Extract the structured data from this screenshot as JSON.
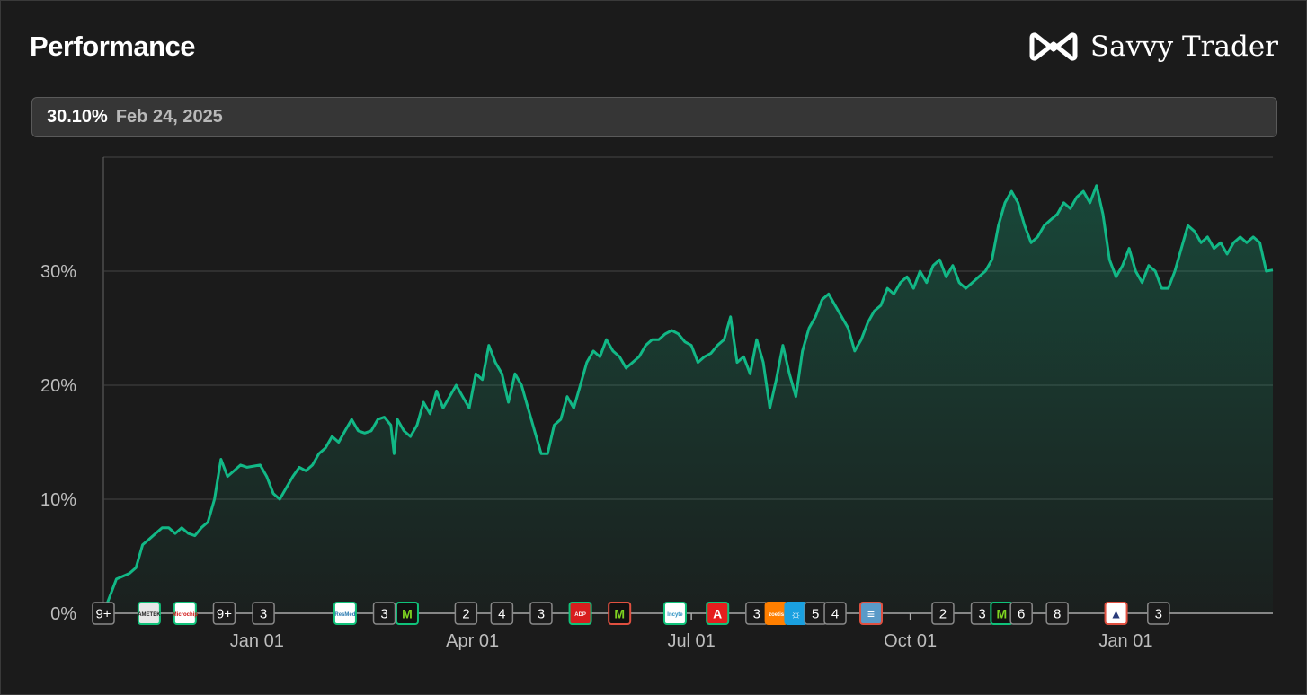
{
  "header": {
    "title": "Performance",
    "brand": "Savvy Trader"
  },
  "tooltip": {
    "value": "30.10%",
    "date": "Feb 24, 2025"
  },
  "colors": {
    "line": "#12b886",
    "grid": "#444444",
    "positive": "#10c27a",
    "negative": "#e05040"
  },
  "chart_data": {
    "type": "area",
    "x_labels": [
      "Jan 01",
      "Apr 01",
      "Jul 01",
      "Oct 01",
      "Jan 01"
    ],
    "y_tick_labels": [
      "0%",
      "10%",
      "20%",
      "30%"
    ],
    "ylim": [
      0,
      40
    ],
    "grid": true,
    "series": [
      {
        "points": [
          [
            0,
            0
          ],
          [
            4,
            3
          ],
          [
            8,
            3.5
          ],
          [
            10,
            4
          ],
          [
            12,
            6
          ],
          [
            14,
            6.5
          ],
          [
            16,
            7
          ],
          [
            18,
            7.5
          ],
          [
            20,
            7.5
          ],
          [
            22,
            7
          ],
          [
            24,
            7.5
          ],
          [
            26,
            7
          ],
          [
            28,
            6.8
          ],
          [
            30,
            7.5
          ],
          [
            32,
            8
          ],
          [
            34,
            10
          ],
          [
            36,
            13.5
          ],
          [
            38,
            12
          ],
          [
            40,
            12.5
          ],
          [
            42,
            13
          ],
          [
            44,
            12.8
          ],
          [
            48,
            13
          ],
          [
            50,
            12
          ],
          [
            52,
            10.5
          ],
          [
            54,
            10
          ],
          [
            56,
            11
          ],
          [
            58,
            12
          ],
          [
            60,
            12.8
          ],
          [
            62,
            12.5
          ],
          [
            64,
            13
          ],
          [
            66,
            14
          ],
          [
            68,
            14.5
          ],
          [
            70,
            15.5
          ],
          [
            72,
            15
          ],
          [
            74,
            16
          ],
          [
            76,
            17
          ],
          [
            78,
            16
          ],
          [
            80,
            15.8
          ],
          [
            82,
            16
          ],
          [
            84,
            17
          ],
          [
            86,
            17.2
          ],
          [
            88,
            16.5
          ],
          [
            89,
            14
          ],
          [
            90,
            17
          ],
          [
            92,
            16
          ],
          [
            94,
            15.5
          ],
          [
            96,
            16.5
          ],
          [
            98,
            18.5
          ],
          [
            100,
            17.5
          ],
          [
            102,
            19.5
          ],
          [
            104,
            18
          ],
          [
            106,
            19
          ],
          [
            108,
            20
          ],
          [
            110,
            19
          ],
          [
            112,
            18
          ],
          [
            114,
            21
          ],
          [
            116,
            20.5
          ],
          [
            118,
            23.5
          ],
          [
            120,
            22
          ],
          [
            122,
            21
          ],
          [
            124,
            18.5
          ],
          [
            126,
            21
          ],
          [
            128,
            20
          ],
          [
            130,
            18
          ],
          [
            132,
            16
          ],
          [
            134,
            14
          ],
          [
            136,
            14
          ],
          [
            138,
            16.5
          ],
          [
            140,
            17
          ],
          [
            142,
            19
          ],
          [
            144,
            18
          ],
          [
            146,
            20
          ],
          [
            148,
            22
          ],
          [
            150,
            23
          ],
          [
            152,
            22.5
          ],
          [
            154,
            24
          ],
          [
            156,
            23
          ],
          [
            158,
            22.5
          ],
          [
            160,
            21.5
          ],
          [
            162,
            22
          ],
          [
            164,
            22.5
          ],
          [
            166,
            23.5
          ],
          [
            168,
            24
          ],
          [
            170,
            24
          ],
          [
            172,
            24.5
          ],
          [
            174,
            24.8
          ],
          [
            176,
            24.5
          ],
          [
            178,
            23.8
          ],
          [
            180,
            23.5
          ],
          [
            182,
            22
          ],
          [
            184,
            22.5
          ],
          [
            186,
            22.8
          ],
          [
            188,
            23.5
          ],
          [
            190,
            24
          ],
          [
            192,
            26
          ],
          [
            194,
            22
          ],
          [
            196,
            22.5
          ],
          [
            198,
            21
          ],
          [
            200,
            24
          ],
          [
            202,
            22
          ],
          [
            204,
            18
          ],
          [
            206,
            20.5
          ],
          [
            208,
            23.5
          ],
          [
            210,
            21
          ],
          [
            212,
            19
          ],
          [
            214,
            23
          ],
          [
            216,
            25
          ],
          [
            218,
            26
          ],
          [
            220,
            27.5
          ],
          [
            222,
            28
          ],
          [
            224,
            27
          ],
          [
            226,
            26
          ],
          [
            228,
            25
          ],
          [
            230,
            23
          ],
          [
            232,
            24
          ],
          [
            234,
            25.5
          ],
          [
            236,
            26.5
          ],
          [
            238,
            27
          ],
          [
            240,
            28.5
          ],
          [
            242,
            28
          ],
          [
            244,
            29
          ],
          [
            246,
            29.5
          ],
          [
            248,
            28.5
          ],
          [
            250,
            30
          ],
          [
            252,
            29
          ],
          [
            254,
            30.5
          ],
          [
            256,
            31
          ],
          [
            258,
            29.5
          ],
          [
            260,
            30.5
          ],
          [
            262,
            29
          ],
          [
            264,
            28.5
          ],
          [
            266,
            29
          ],
          [
            268,
            29.5
          ],
          [
            270,
            30
          ],
          [
            272,
            31
          ],
          [
            274,
            34
          ],
          [
            276,
            36
          ],
          [
            278,
            37
          ],
          [
            280,
            36
          ],
          [
            282,
            34
          ],
          [
            284,
            32.5
          ],
          [
            286,
            33
          ],
          [
            288,
            34
          ],
          [
            290,
            34.5
          ],
          [
            292,
            35
          ],
          [
            294,
            36
          ],
          [
            296,
            35.5
          ],
          [
            298,
            36.5
          ],
          [
            300,
            37
          ],
          [
            302,
            36
          ],
          [
            304,
            37.5
          ],
          [
            306,
            35
          ],
          [
            308,
            31
          ],
          [
            310,
            29.5
          ],
          [
            312,
            30.5
          ],
          [
            314,
            32
          ],
          [
            316,
            30
          ],
          [
            318,
            29
          ],
          [
            320,
            30.5
          ],
          [
            322,
            30
          ],
          [
            324,
            28.5
          ],
          [
            326,
            28.5
          ],
          [
            328,
            30
          ],
          [
            330,
            32
          ],
          [
            332,
            34
          ],
          [
            334,
            33.5
          ],
          [
            336,
            32.5
          ],
          [
            338,
            33
          ],
          [
            340,
            32
          ],
          [
            342,
            32.5
          ],
          [
            344,
            31.5
          ],
          [
            346,
            32.5
          ],
          [
            348,
            33
          ],
          [
            350,
            32.5
          ],
          [
            352,
            33
          ],
          [
            354,
            32.5
          ],
          [
            356,
            30
          ],
          [
            358,
            30.1
          ]
        ]
      }
    ]
  },
  "markers": [
    {
      "pos": 0,
      "label": "9+",
      "style": "count"
    },
    {
      "pos": 14,
      "label": "AMETEK",
      "style": "logo",
      "bg": "#e8e8e8",
      "fg": "#222222",
      "border": "#10c27a"
    },
    {
      "pos": 25,
      "label": "Microchip",
      "style": "logo",
      "bg": "#ffffff",
      "fg": "#d01010",
      "border": "#10c27a"
    },
    {
      "pos": 37,
      "label": "9+",
      "style": "count"
    },
    {
      "pos": 49,
      "label": "3",
      "style": "count"
    },
    {
      "pos": 74,
      "label": "ResMed",
      "style": "logo",
      "bg": "#ffffff",
      "fg": "#2a7ab0",
      "border": "#10c27a"
    },
    {
      "pos": 86,
      "label": "3",
      "style": "count"
    },
    {
      "pos": 93,
      "label": "M",
      "style": "logo",
      "bg": "#111111",
      "fg": "#7ed321",
      "border": "#10c27a"
    },
    {
      "pos": 111,
      "label": "2",
      "style": "count"
    },
    {
      "pos": 122,
      "label": "4",
      "style": "count"
    },
    {
      "pos": 134,
      "label": "3",
      "style": "count"
    },
    {
      "pos": 146,
      "label": "ADP",
      "style": "logo",
      "bg": "#d81e1e",
      "fg": "#ffffff",
      "border": "#10c27a"
    },
    {
      "pos": 158,
      "label": "M",
      "style": "logo",
      "bg": "#111111",
      "fg": "#7ed321",
      "border": "#e05040"
    },
    {
      "pos": 175,
      "label": "Incyte",
      "style": "logo",
      "bg": "#ffffff",
      "fg": "#2a90c0",
      "border": "#10c27a"
    },
    {
      "pos": 188,
      "label": "A",
      "style": "logo",
      "bg": "#e51e1e",
      "fg": "#ffffff",
      "border": "#10c27a"
    },
    {
      "pos": 200,
      "label": "3",
      "style": "count"
    },
    {
      "pos": 206,
      "label": "zoetis",
      "style": "logo",
      "bg": "#ff7f00",
      "fg": "#ffffff",
      "border": "#ff7f00"
    },
    {
      "pos": 212,
      "label": "☼",
      "style": "logo",
      "bg": "#1aa0e0",
      "fg": "#ffffff",
      "border": "#1aa0e0"
    },
    {
      "pos": 218,
      "label": "5",
      "style": "count"
    },
    {
      "pos": 224,
      "label": "4",
      "style": "count"
    },
    {
      "pos": 235,
      "label": "≡",
      "style": "logo",
      "bg": "#5a9ac8",
      "fg": "#ffffff",
      "border": "#e05040"
    },
    {
      "pos": 257,
      "label": "2",
      "style": "count"
    },
    {
      "pos": 269,
      "label": "3",
      "style": "count"
    },
    {
      "pos": 275,
      "label": "M",
      "style": "logo",
      "bg": "#111111",
      "fg": "#7ed321",
      "border": "#10c27a"
    },
    {
      "pos": 281,
      "label": "6",
      "style": "count"
    },
    {
      "pos": 292,
      "label": "8",
      "style": "count"
    },
    {
      "pos": 310,
      "label": "▲",
      "style": "logo",
      "bg": "#ffffff",
      "fg": "#2a3a7a",
      "border": "#e05040"
    },
    {
      "pos": 323,
      "label": "3",
      "style": "count"
    }
  ]
}
